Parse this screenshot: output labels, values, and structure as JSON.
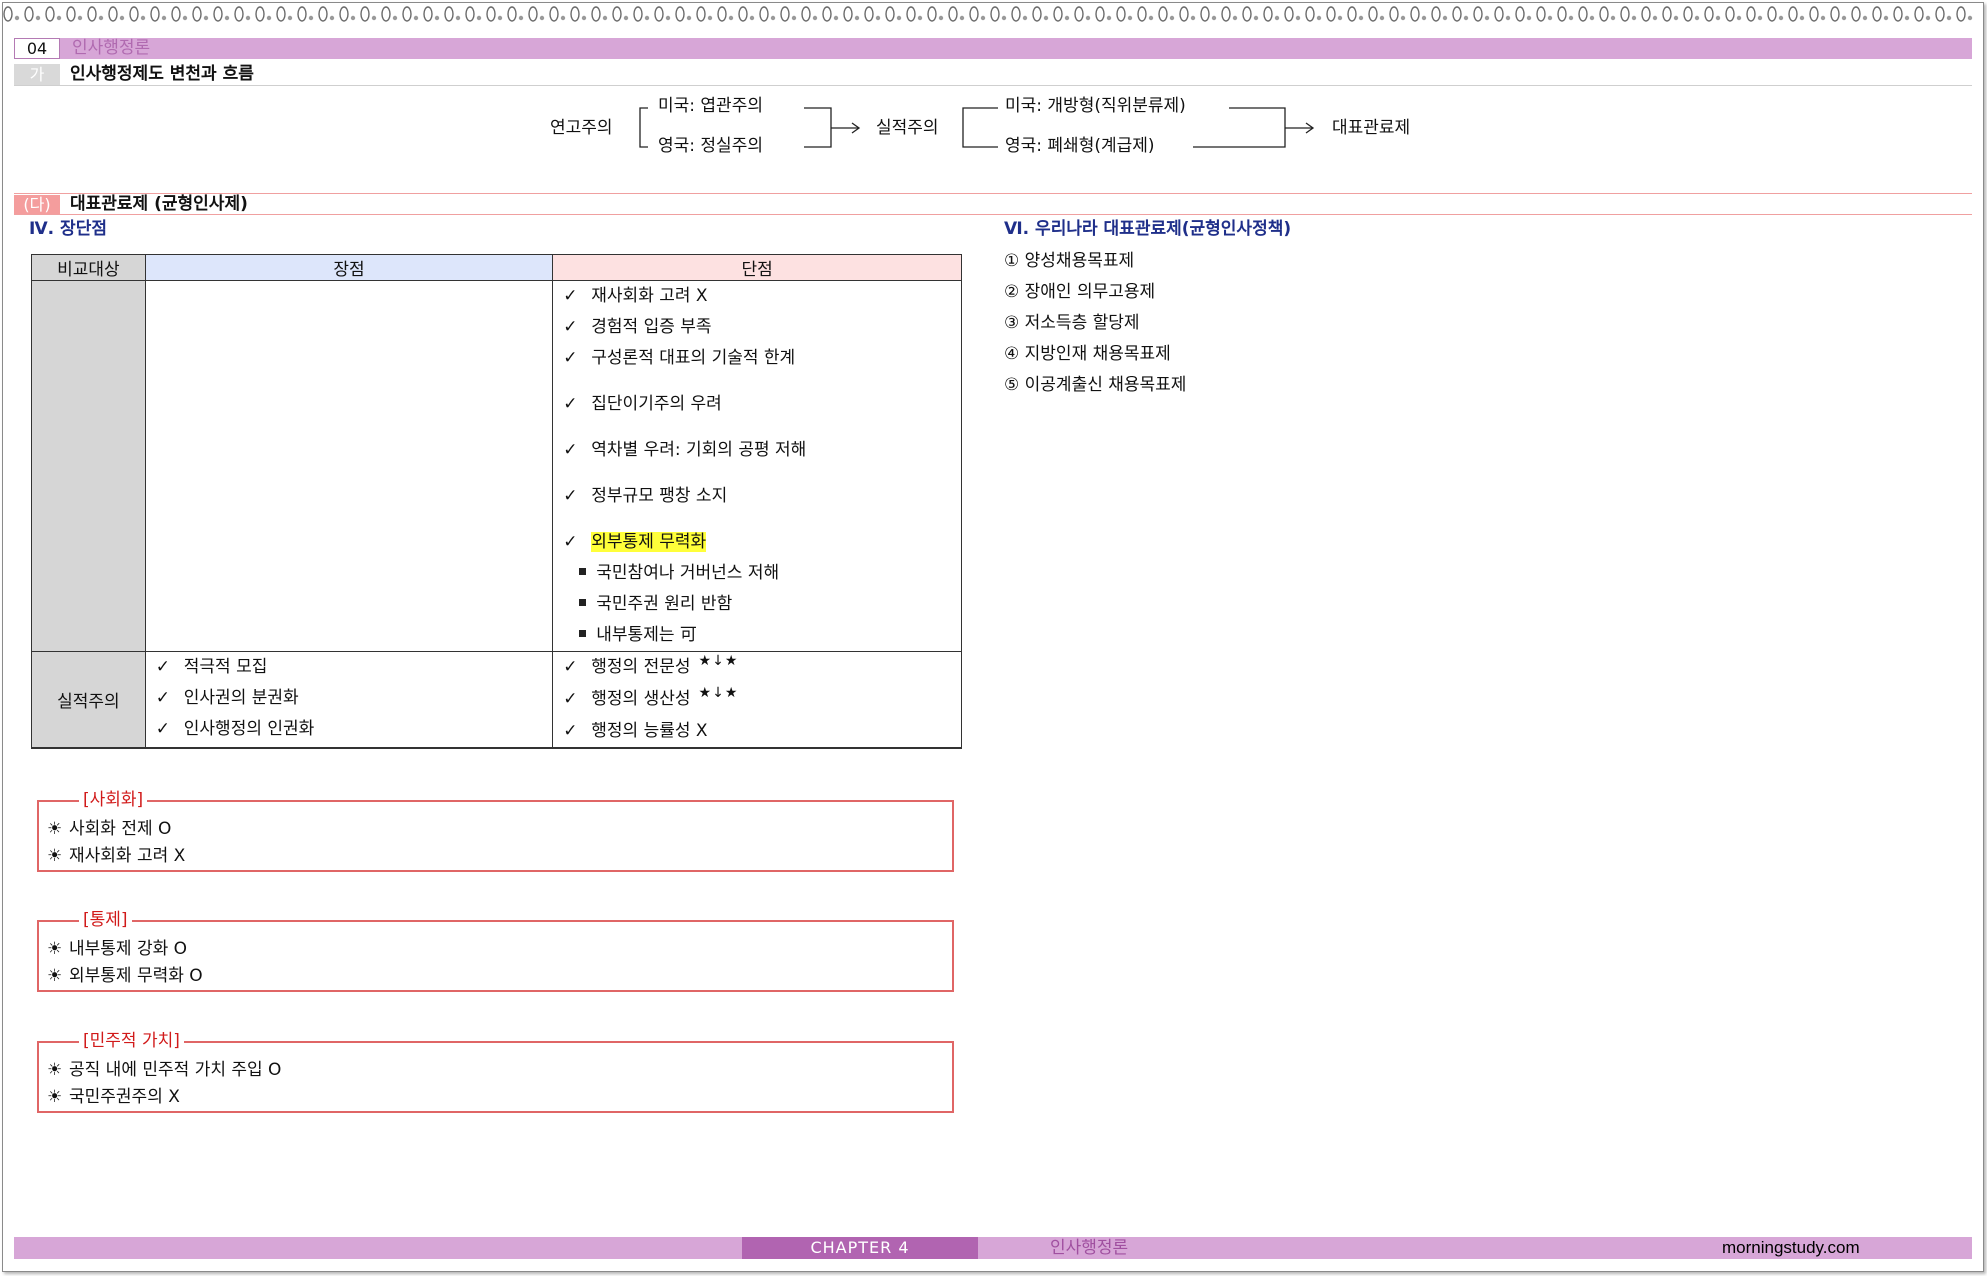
{
  "header": {
    "chapter_num": "04",
    "chapter_title": "인사행정론"
  },
  "section_ga": {
    "marker": "가",
    "title": "인사행정제도 변천과 흐름"
  },
  "flow": {
    "seniority": "연고주의",
    "us_spoils": "미국: 엽관주의",
    "uk_patronage": "영국: 정실주의",
    "merit": "실적주의",
    "us_open": "미국: 개방형(직위분류제)",
    "uk_closed": "영국: 폐쇄형(계급제)",
    "representative": "대표관료제"
  },
  "section_da": {
    "marker": "(다)",
    "title": "대표관료제 (균형인사제)"
  },
  "pros_cons": {
    "heading": "Ⅳ. 장단점",
    "col_subject": "비교대상",
    "col_pros": "장점",
    "col_cons": "단점",
    "check": "✓",
    "row1_cons": [
      {
        "text": "재사회화 고려 X"
      },
      {
        "text": "경험적 입증 부족"
      },
      {
        "text": "구성론적 대표의 기술적 한계"
      },
      {
        "text": "집단이기주의 우려"
      },
      {
        "text": "역차별 우려: 기회의 공평 저해"
      },
      {
        "text": "정부규모 팽창 소지"
      }
    ],
    "row1_highlight": "외부통제 무력화",
    "row1_subitems": [
      "국민참여나 거버넌스 저해",
      "국민주권 원리 반함",
      "내부통제는 可"
    ],
    "row2_subject": "실적주의",
    "row2_pros": [
      "적극적 모집",
      "인사권의 분권화",
      "인사행정의 인권화"
    ],
    "row2_cons": [
      "행정의 전문성",
      "행정의 생산성",
      "행정의 능률성 X"
    ],
    "stars_mark": "★↓★"
  },
  "boxes": [
    {
      "title": "[사회화]",
      "lines": [
        "사회화 전제 O",
        "재사회화 고려 X"
      ]
    },
    {
      "title": "[통제]",
      "lines": [
        "내부통제 강화 O",
        "외부통제 무력화 O"
      ]
    },
    {
      "title": "[민주적 가치]",
      "lines": [
        "공직 내에 민주적 가치 주입 O",
        "국민주권주의 X"
      ]
    }
  ],
  "sun_symbol": "☀",
  "korea_policy": {
    "heading": "Ⅵ. 우리나라 대표관료제(균형인사정책)",
    "items": [
      "① 양성채용목표제",
      "② 장애인 의무고용제",
      "③ 저소득층 할당제",
      "④ 지방인재 채용목표제",
      "⑤ 이공계출신 채용목표제"
    ]
  },
  "footer": {
    "chapter": "CHAPTER 4",
    "title": "인사행정론",
    "site": "morningstudy.com"
  }
}
